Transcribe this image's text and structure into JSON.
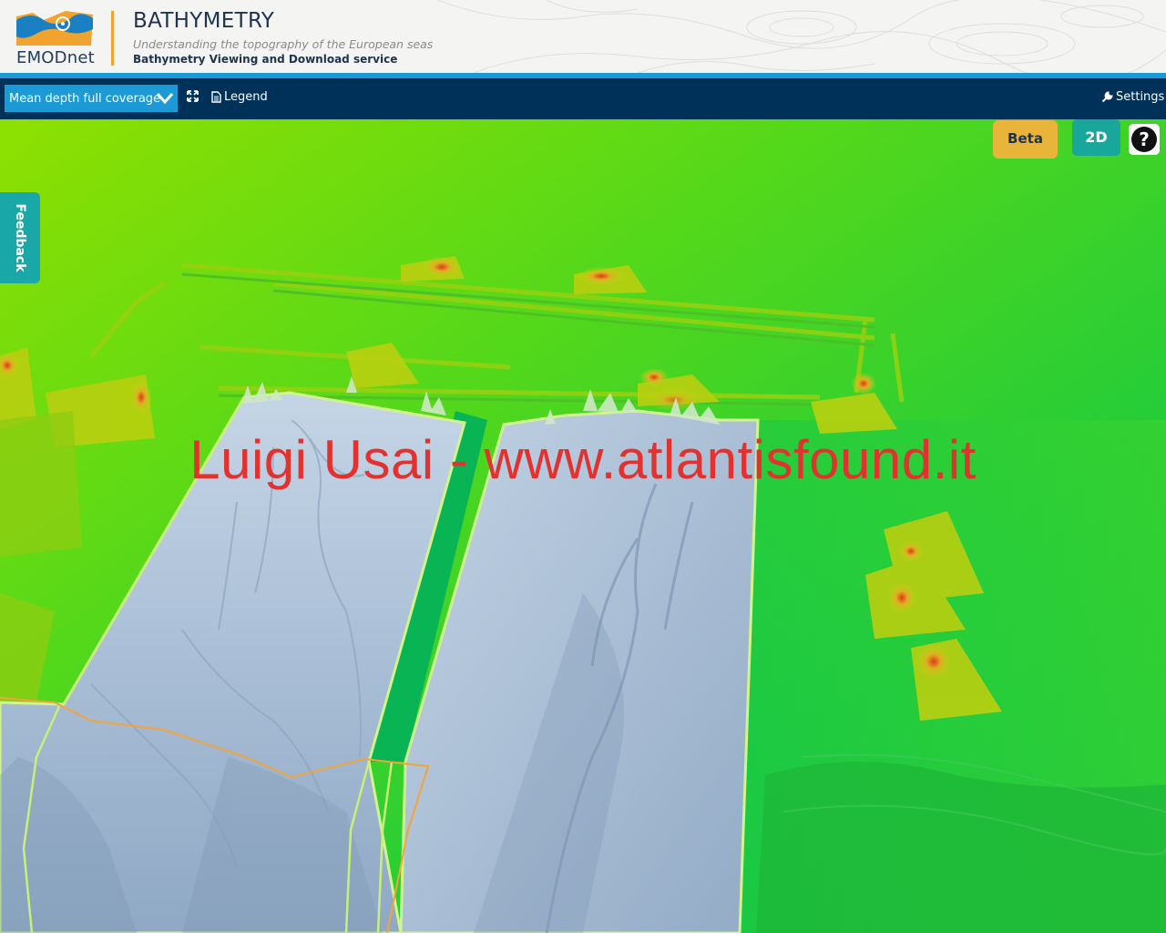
{
  "header": {
    "logo_text": "EMODnet",
    "title": "BATHYMETRY",
    "subtitle": "Understanding the topography of the European seas",
    "service": "Bathymetry Viewing and Download service"
  },
  "toolbar": {
    "layer_select_value": "Mean depth full coverage",
    "fullscreen_icon": "expand-icon",
    "legend_label": "Legend",
    "legend_icon": "document-icon",
    "settings_label": "Settings",
    "settings_icon": "wrench-icon"
  },
  "map": {
    "watermark": "Luigi Usai - www.atlantisfound.it",
    "beta_label": "Beta",
    "view_mode_label": "2D",
    "help_label": "?",
    "feedback_label": "Feedback"
  },
  "colors": {
    "toolbar_bg": "#003158",
    "accent_blue": "#1b9ad6",
    "beta_bg": "#e8b43a",
    "mode_bg": "#1aa79b",
    "feedback_bg": "#1aa7a7",
    "watermark": "#e1322f",
    "logo_orange": "#f0a32e"
  }
}
